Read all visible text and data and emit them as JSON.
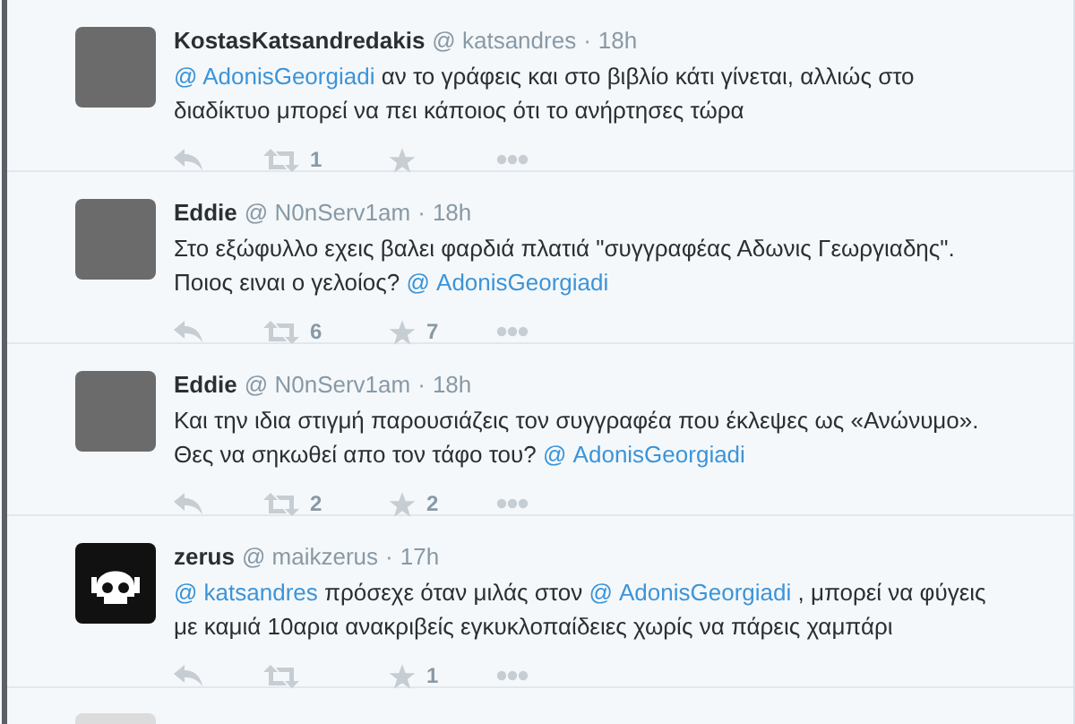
{
  "tweets": [
    {
      "name": "KostasKatsandredakis",
      "handle": "@ katsandres",
      "separator": "·",
      "time": "18h",
      "avatar": {
        "kind": "photo"
      },
      "lines": [
        [
          {
            "kind": "mention",
            "text": "@ AdonisGeorgiadi"
          },
          {
            "kind": "text",
            "text": " αν το γράφεις και στο βιβλίο κάτι γίνεται, αλλιώς στο"
          }
        ],
        [
          {
            "kind": "text",
            "text": "διαδίκτυο μπορεί να πει κάποιος ότι το ανήρτησες τώρα"
          }
        ]
      ],
      "retweets": "1"
    },
    {
      "name": "Eddie",
      "handle": "@ N0nServ1am",
      "separator": "·",
      "time": "18h",
      "avatar": {
        "kind": "photo"
      },
      "lines": [
        [
          {
            "kind": "text",
            "text": "Στο εξώφυλλο εχεις βαλει φαρδιά πλατιά \"συγγραφέας Αδωνις Γεωργιαδης\"."
          }
        ],
        [
          {
            "kind": "text",
            "text": "Ποιος ειναι ο γελοίος? "
          },
          {
            "kind": "mention",
            "text": "@ AdonisGeorgiadi"
          }
        ]
      ],
      "retweets": "6",
      "favorites": "7"
    },
    {
      "name": "Eddie",
      "handle": "@ N0nServ1am",
      "separator": "·",
      "time": "18h",
      "avatar": {
        "kind": "photo"
      },
      "lines": [
        [
          {
            "kind": "text",
            "text": "Και την ιδια στιγμή παρουσιάζεις τον συγγραφέα που έκλεψες ως «Ανώνυμο»."
          }
        ],
        [
          {
            "kind": "text",
            "text": "Θες να σηκωθεί απο τον τάφο του? "
          },
          {
            "kind": "mention",
            "text": "@ AdonisGeorgiadi"
          }
        ]
      ],
      "retweets": "2",
      "favorites": "2"
    },
    {
      "name": "zerus",
      "handle": "@ maikzerus",
      "separator": "·",
      "time": "17h",
      "avatar": {
        "kind": "skull"
      },
      "lines": [
        [
          {
            "kind": "mention",
            "text": "@ katsandres"
          },
          {
            "kind": "text",
            "text": " πρόσεχε όταν μιλάς στον "
          },
          {
            "kind": "mention",
            "text": "@ AdonisGeorgiadi"
          },
          {
            "kind": "text",
            "text": " , μπορεί να φύγεις"
          }
        ],
        [
          {
            "kind": "text",
            "text": "με καμιά 10αρια ανακριβείς εγκυκλοπαίδειες χωρίς να πάρεις χαμπάρι"
          }
        ]
      ],
      "favorites": "1"
    }
  ]
}
